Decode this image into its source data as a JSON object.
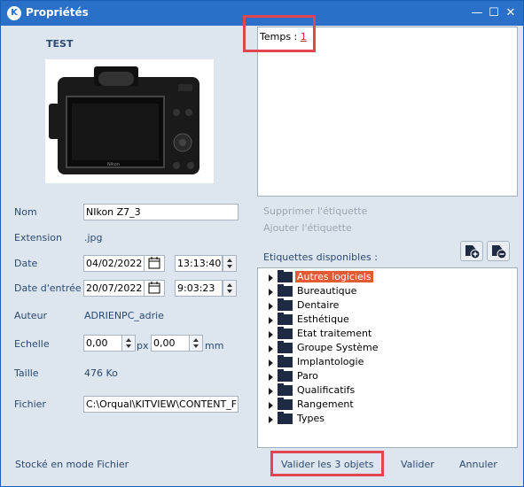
{
  "window": {
    "title": "Propriétés",
    "logo_text": "K"
  },
  "image_panel": {
    "title": "TEST",
    "camera_brand": "Nikon"
  },
  "form": {
    "nom_label": "Nom",
    "nom_value": "NIkon Z7_3",
    "extension_label": "Extension",
    "extension_value": ".jpg",
    "date_label": "Date",
    "date_value": "04/02/2022",
    "time_value": "13:13:40",
    "date_entree_label": "Date d'entrée",
    "date_entree_value": "20/07/2022",
    "time_entree_value": "9:03:23",
    "auteur_label": "Auteur",
    "auteur_value": "ADRIENPC_adrie",
    "echelle_label": "Echelle",
    "echelle_x": "0,00",
    "echelle_x_unit": "px",
    "echelle_y": "0,00",
    "echelle_y_unit": "mm",
    "taille_label": "Taille",
    "taille_value": "476 Ko",
    "fichier_label": "Fichier",
    "fichier_value": "C:\\Orqual\\KITVIEW\\CONTENT_FR"
  },
  "notes": {
    "temps_label": "Temps :",
    "temps_value": "1"
  },
  "tags": {
    "remove_label": "Supprimer l'étiquette",
    "add_label": "Ajouter l'étiquette",
    "available_label": "Etiquettes disponibles :",
    "items": [
      "Autres logiciels",
      "Bureautique",
      "Dentaire",
      "Esthétique",
      "Etat traitement",
      "Groupe Système",
      "Implantologie",
      "Paro",
      "Qualificatifs",
      "Rangement",
      "Types"
    ]
  },
  "footer": {
    "storage_text": "Stocké en mode Fichier",
    "validate_all": "Valider les 3 objets",
    "validate": "Valider",
    "cancel": "Annuler"
  },
  "colors": {
    "titlebar": "#2a6fc8",
    "panel": "#dde6ef",
    "highlight_box": "#e2454f",
    "selected_tag": "#e35a33"
  }
}
